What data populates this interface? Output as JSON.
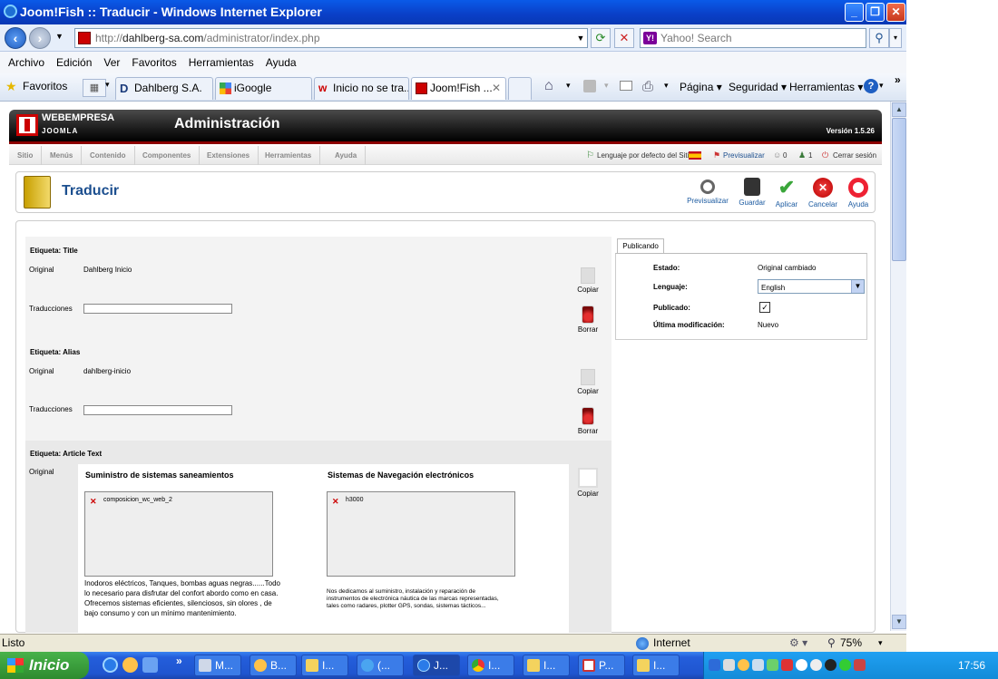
{
  "window": {
    "title": "Joom!Fish :: Traducir - Windows Internet Explorer",
    "min": "_",
    "max": "❐",
    "close": "✕"
  },
  "address": {
    "url_prefix": "http://",
    "url_host": "dahlberg-sa.com",
    "url_path": "/administrator/index.php",
    "search_placeholder": "Yahoo! Search"
  },
  "menu": [
    "Archivo",
    "Edición",
    "Ver",
    "Favoritos",
    "Herramientas",
    "Ayuda"
  ],
  "favbar": {
    "favorites": "Favoritos",
    "tabs": [
      "Dahlberg S.A.",
      "iGoogle",
      "Inicio no se tra...",
      "Joom!Fish ..."
    ],
    "commands": [
      "Página ▾",
      "Seguridad ▾",
      "Herramientas ▾"
    ],
    "chevron": "»"
  },
  "joomla": {
    "brand": "WEBEMPRESA",
    "brand_sub": "JOOMLA",
    "admin_title": "Administración",
    "version": "Versión 1.5.26",
    "menu": [
      "Sitio",
      "Menús",
      "Contenido",
      "Componentes",
      "Extensiones",
      "Herramientas",
      "Ayuda"
    ],
    "status": {
      "default_lang": "Lenguaje por defecto del Sitio",
      "preview": "Previsualizar",
      "count_a": "0",
      "count_b": "1",
      "logout": "Cerrar sesión"
    },
    "page_title": "Traducir",
    "toolbar": [
      "Previsualizar",
      "Guardar",
      "Aplicar",
      "Cancelar",
      "Ayuda"
    ]
  },
  "form": {
    "title_label": "Etiqueta: Title",
    "original_label": "Original",
    "title_original": "Dahlberg Inicio",
    "translations_label": "Traducciones",
    "copy_label": "Copiar",
    "delete_label": "Borrar",
    "alias_label": "Etiqueta: Alias",
    "alias_original": "dahlberg-inicio",
    "article_label": "Etiqueta: Article Text",
    "col1_heading": "Suministro de sistemas saneamientos",
    "col1_image": "composicion_wc_web_2",
    "col1_text": "Inodoros eléctricos,  Tanques, bombas aguas negras......Todo lo necesario para disfrutar del confort abordo como en casa. Ofrecemos sistemas eficientes, silenciosos, sin olores , de bajo consumo y con un mínimo mantenimiento.",
    "col2_heading": "Sistemas de Navegación electrónicos",
    "col2_image": "h3000",
    "col2_text": "Nos dedicamos al suministro, instalación y reparación de instrumentos de electrónica náutica de las marcas representadas, tales como radares, plotter GPS, sondas, sistemas tácticos..."
  },
  "publish": {
    "tab": "Publicando",
    "estado_label": "Estado:",
    "estado_value": "Original cambiado",
    "lenguaje_label": "Lenguaje:",
    "lenguaje_value": "English",
    "publicado_label": "Publicado:",
    "ultima_label": "Última modificación:",
    "ultima_value": "Nuevo"
  },
  "statusbar": {
    "left": "Listo",
    "zone": "Internet",
    "zoom": "75%"
  },
  "taskbar": {
    "start": "Inicio",
    "tasks": [
      "M...",
      "B...",
      "I...",
      "(...",
      "J...",
      "I...",
      "I...",
      "P...",
      "I..."
    ],
    "clock": "17:56"
  },
  "colors": {
    "ie_title": "#0a48d8",
    "joomla_accent": "#8c0000",
    "link_blue": "#1c4f8f"
  }
}
